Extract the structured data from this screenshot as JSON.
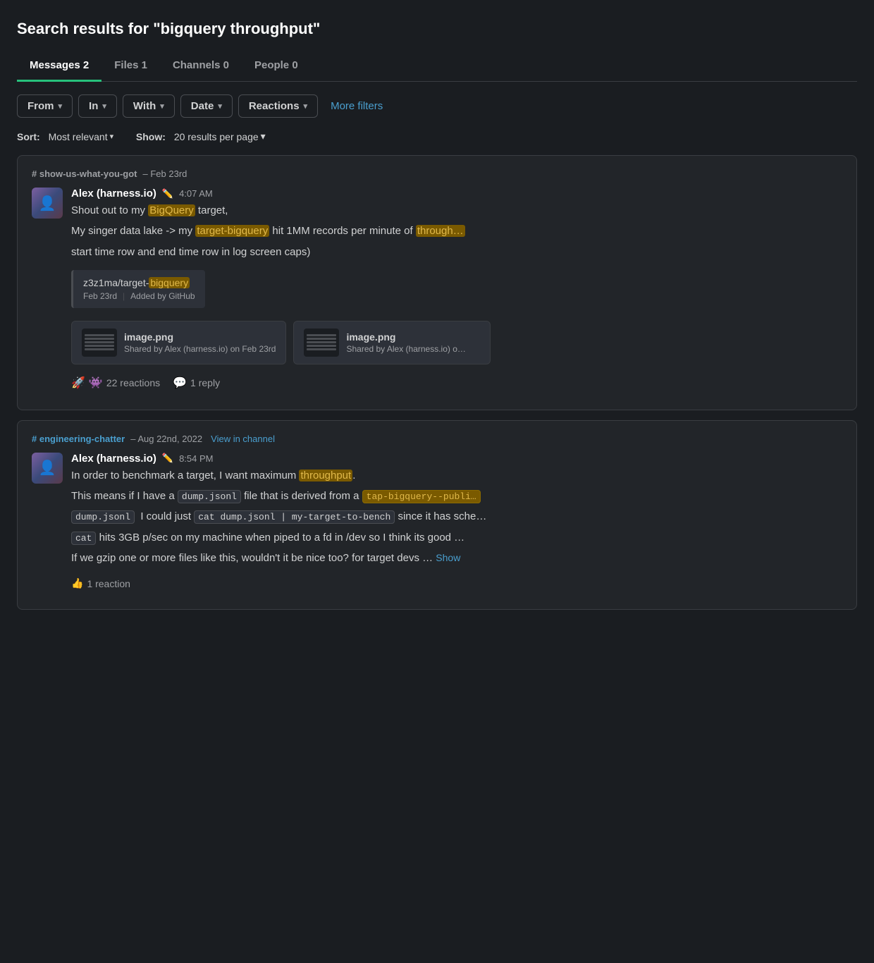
{
  "page": {
    "title": "Search results for \"bigquery throughput\""
  },
  "tabs": [
    {
      "id": "messages",
      "label": "Messages",
      "count": "2",
      "active": true
    },
    {
      "id": "files",
      "label": "Files",
      "count": "1",
      "active": false
    },
    {
      "id": "channels",
      "label": "Channels",
      "count": "0",
      "active": false
    },
    {
      "id": "people",
      "label": "People",
      "count": "0",
      "active": false
    }
  ],
  "filters": [
    {
      "id": "from",
      "label": "From",
      "chevron": "▾"
    },
    {
      "id": "in",
      "label": "In",
      "chevron": "▾"
    },
    {
      "id": "with",
      "label": "With",
      "chevron": "▾"
    },
    {
      "id": "date",
      "label": "Date",
      "chevron": "▾"
    },
    {
      "id": "reactions",
      "label": "Reactions",
      "chevron": "▾"
    }
  ],
  "more_filters_label": "More filters",
  "sort": {
    "label": "Sort:",
    "value": "Most relevant",
    "chevron": "▾"
  },
  "show": {
    "label": "Show:",
    "value": "20 results per page",
    "chevron": "▾"
  },
  "results": [
    {
      "id": "result-1",
      "channel": "# show-us-what-you-got",
      "channel_linked": false,
      "date": "– Feb 23rd",
      "view_in_channel": null,
      "author": "Alex (harness.io)",
      "time": "4:07 AM",
      "message_parts": [
        {
          "type": "text",
          "text": "Shout out to my "
        },
        {
          "type": "highlight",
          "text": "BigQuery"
        },
        {
          "type": "text",
          "text": " target,"
        }
      ],
      "message_line2_parts": [
        {
          "type": "text",
          "text": "My singer data lake -> my "
        },
        {
          "type": "highlight",
          "text": "target-bigquery"
        },
        {
          "type": "text",
          "text": " hit 1MM records per minute of "
        },
        {
          "type": "highlight",
          "text": "through…"
        }
      ],
      "message_line3": "start time row and end time row in log screen caps)",
      "link_preview": {
        "text_before": "z3z1ma/target-",
        "text_highlight": "bigquery",
        "date": "Feb 23rd",
        "added_by": "Added by GitHub"
      },
      "files": [
        {
          "name": "image.png",
          "meta": "Shared by Alex (harness.io) on Feb 23rd"
        },
        {
          "name": "image.png",
          "meta": "Shared by Alex (harness.io) o…"
        }
      ],
      "reactions": {
        "emojis": [
          "🚀",
          "👾"
        ],
        "count": "22 reactions"
      },
      "replies": {
        "count": "1 reply"
      }
    },
    {
      "id": "result-2",
      "channel": "# engineering-chatter",
      "channel_linked": true,
      "date": "– Aug 22nd, 2022",
      "view_in_channel": "View in channel",
      "author": "Alex (harness.io)",
      "time": "8:54 PM",
      "message_parts": [
        {
          "type": "text",
          "text": "In order to benchmark a target, I want maximum "
        },
        {
          "type": "highlight",
          "text": "throughput"
        },
        {
          "type": "text",
          "text": "."
        }
      ],
      "message_line2_parts": [
        {
          "type": "text",
          "text": "This means if I have a "
        },
        {
          "type": "code",
          "text": "dump.jsonl"
        },
        {
          "type": "text",
          "text": " file that is derived from a "
        },
        {
          "type": "code-highlight",
          "text": "tap-bigquery--publi…"
        }
      ],
      "message_line3_parts": [
        {
          "type": "code",
          "text": "dump.jsonl"
        },
        {
          "type": "text",
          "text": "  I could just "
        },
        {
          "type": "code-cmd",
          "text": "cat dump.jsonl | my-target-to-bench"
        },
        {
          "type": "text",
          "text": " since it has sche…"
        }
      ],
      "message_line4_parts": [
        {
          "type": "code",
          "text": "cat"
        },
        {
          "type": "text",
          "text": " hits 3GB p/sec on my machine when piped to a fd in /dev so I think its good …"
        }
      ],
      "message_line5": "If we gzip one or more files like this, wouldn't it be nice too? for target devs …",
      "show_more": "Show",
      "reactions": {
        "emojis": [
          "👍"
        ],
        "count": "1 reaction"
      },
      "replies": null
    }
  ]
}
